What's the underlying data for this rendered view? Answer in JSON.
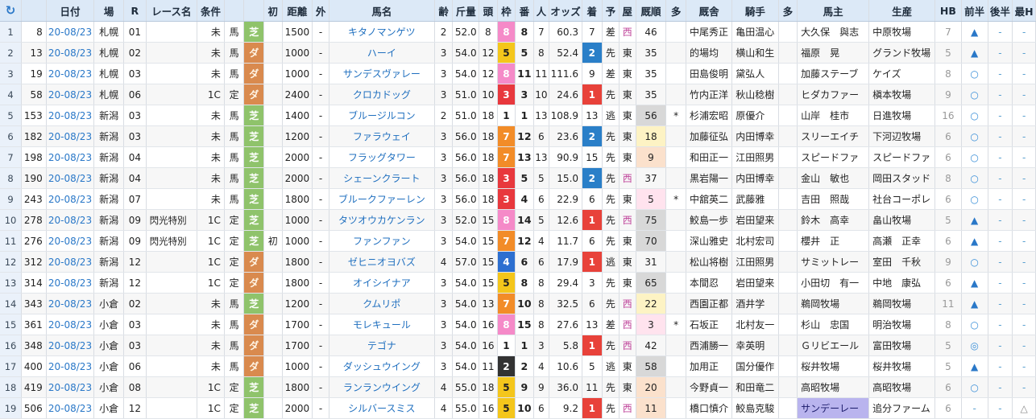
{
  "headers": [
    "",
    "日付",
    "場",
    "R",
    "レース名",
    "条件",
    "",
    "",
    "初",
    "距離",
    "外",
    "馬名",
    "齢",
    "斤量",
    "頭",
    "枠",
    "番",
    "人",
    "オッズ",
    "着",
    "予",
    "屋",
    "厩順",
    "多",
    "厩舎",
    "騎手",
    "多",
    "馬主",
    "生産",
    "HB",
    "前半",
    "後半",
    "最H"
  ],
  "refresh_glyph": "↻",
  "rows": [
    {
      "n": "1",
      "id": "8",
      "date": "20-08/23",
      "venue": "札幌",
      "r": "01",
      "race": "",
      "cls": "未",
      "sex": "馬",
      "course": "芝",
      "first": "",
      "dist": "1500",
      "out": "-",
      "horse": "キタノマンゲツ",
      "age": "2",
      "kin": "52.0",
      "tou": "8",
      "waku": "8",
      "ban": "8",
      "ninki": "7",
      "odds": "60.3",
      "chaku": "7",
      "yo": "差",
      "ya": "西",
      "rk": "46",
      "rkc": "",
      "ta": "",
      "trainer": "中尾秀正",
      "jockey": "亀田温心",
      "ta2": "",
      "owner": "大久保　與志",
      "breeder": "中原牧場",
      "hb": "7",
      "zen": "▲",
      "kou": "-",
      "sai": "-"
    },
    {
      "n": "2",
      "id": "13",
      "date": "20-08/23",
      "venue": "札幌",
      "r": "02",
      "race": "",
      "cls": "未",
      "sex": "馬",
      "course": "ダ",
      "first": "",
      "dist": "1000",
      "out": "-",
      "horse": "ハーイ",
      "age": "3",
      "kin": "54.0",
      "tou": "12",
      "waku": "5",
      "ban": "5",
      "ninki": "8",
      "odds": "52.4",
      "chaku": "2",
      "yo": "先",
      "ya": "東",
      "rk": "35",
      "rkc": "",
      "ta": "",
      "trainer": "的場均",
      "jockey": "横山和生",
      "ta2": "",
      "owner": "福原　晃",
      "breeder": "グランド牧場",
      "hb": "5",
      "zen": "▲",
      "kou": "-",
      "sai": "-"
    },
    {
      "n": "3",
      "id": "19",
      "date": "20-08/23",
      "venue": "札幌",
      "r": "03",
      "race": "",
      "cls": "未",
      "sex": "馬",
      "course": "ダ",
      "first": "",
      "dist": "1000",
      "out": "-",
      "horse": "サンデスヴァレー",
      "age": "3",
      "kin": "54.0",
      "tou": "12",
      "waku": "8",
      "ban": "11",
      "ninki": "11",
      "odds": "111.6",
      "chaku": "9",
      "yo": "差",
      "ya": "東",
      "rk": "35",
      "rkc": "",
      "ta": "",
      "trainer": "田島俊明",
      "jockey": "黛弘人",
      "ta2": "",
      "owner": "加藤ステーブ",
      "breeder": "ケイズ",
      "hb": "8",
      "zen": "○",
      "kou": "-",
      "sai": "-"
    },
    {
      "n": "4",
      "id": "58",
      "date": "20-08/23",
      "venue": "札幌",
      "r": "06",
      "race": "",
      "cls": "1C",
      "sex": "定",
      "course": "ダ",
      "first": "",
      "dist": "2400",
      "out": "-",
      "horse": "クロカドッグ",
      "age": "3",
      "kin": "51.0",
      "tou": "10",
      "waku": "3",
      "ban": "3",
      "ninki": "10",
      "odds": "24.6",
      "chaku": "1",
      "yo": "先",
      "ya": "東",
      "rk": "35",
      "rkc": "",
      "ta": "",
      "trainer": "竹内正洋",
      "jockey": "秋山稔樹",
      "ta2": "",
      "owner": "ヒダカファー",
      "breeder": "槇本牧場",
      "hb": "9",
      "zen": "○",
      "kou": "-",
      "sai": "-"
    },
    {
      "n": "5",
      "id": "153",
      "date": "20-08/23",
      "venue": "新潟",
      "r": "03",
      "race": "",
      "cls": "未",
      "sex": "馬",
      "course": "芝",
      "first": "",
      "dist": "1400",
      "out": "-",
      "horse": "ブルージルコン",
      "age": "2",
      "kin": "51.0",
      "tou": "18",
      "waku": "1",
      "ban": "1",
      "ninki": "13",
      "odds": "108.9",
      "chaku": "13",
      "yo": "逃",
      "ya": "東",
      "rk": "56",
      "rkc": "gray",
      "ta": "*",
      "trainer": "杉浦宏昭",
      "jockey": "原優介",
      "ta2": "",
      "owner": "山岸　桂市",
      "breeder": "日進牧場",
      "hb": "16",
      "zen": "○",
      "kou": "-",
      "sai": "-"
    },
    {
      "n": "6",
      "id": "182",
      "date": "20-08/23",
      "venue": "新潟",
      "r": "03",
      "race": "",
      "cls": "未",
      "sex": "馬",
      "course": "芝",
      "first": "",
      "dist": "1200",
      "out": "-",
      "horse": "ファラウェイ",
      "age": "3",
      "kin": "56.0",
      "tou": "18",
      "waku": "7",
      "ban": "12",
      "ninki": "6",
      "odds": "23.6",
      "chaku": "2",
      "yo": "先",
      "ya": "東",
      "rk": "18",
      "rkc": "mid",
      "ta": "",
      "trainer": "加藤征弘",
      "jockey": "内田博幸",
      "ta2": "",
      "owner": "スリーエイチ",
      "breeder": "下河辺牧場",
      "hb": "6",
      "zen": "○",
      "kou": "-",
      "sai": "-"
    },
    {
      "n": "7",
      "id": "198",
      "date": "20-08/23",
      "venue": "新潟",
      "r": "04",
      "race": "",
      "cls": "未",
      "sex": "馬",
      "course": "芝",
      "first": "",
      "dist": "2000",
      "out": "-",
      "horse": "フラッグタワー",
      "age": "3",
      "kin": "56.0",
      "tou": "18",
      "waku": "7",
      "ban": "13",
      "ninki": "13",
      "odds": "90.9",
      "chaku": "15",
      "yo": "先",
      "ya": "東",
      "rk": "9",
      "rkc": "hi",
      "ta": "",
      "trainer": "和田正一",
      "jockey": "江田照男",
      "ta2": "",
      "owner": "スピードファ",
      "breeder": "スピードファ",
      "hb": "6",
      "zen": "○",
      "kou": "-",
      "sai": "-"
    },
    {
      "n": "8",
      "id": "190",
      "date": "20-08/23",
      "venue": "新潟",
      "r": "04",
      "race": "",
      "cls": "未",
      "sex": "馬",
      "course": "芝",
      "first": "",
      "dist": "2000",
      "out": "-",
      "horse": "シェーンクラート",
      "age": "3",
      "kin": "56.0",
      "tou": "18",
      "waku": "3",
      "ban": "5",
      "ninki": "5",
      "odds": "15.0",
      "chaku": "2",
      "yo": "先",
      "ya": "西",
      "rk": "37",
      "rkc": "",
      "ta": "",
      "trainer": "黒岩陽一",
      "jockey": "内田博幸",
      "ta2": "",
      "owner": "金山　敏也",
      "breeder": "岡田スタッド",
      "hb": "8",
      "zen": "○",
      "kou": "-",
      "sai": "-"
    },
    {
      "n": "9",
      "id": "243",
      "date": "20-08/23",
      "venue": "新潟",
      "r": "07",
      "race": "",
      "cls": "未",
      "sex": "馬",
      "course": "芝",
      "first": "",
      "dist": "1800",
      "out": "-",
      "horse": "ブルークファーレン",
      "age": "3",
      "kin": "56.0",
      "tou": "18",
      "waku": "3",
      "ban": "4",
      "ninki": "6",
      "odds": "22.9",
      "chaku": "6",
      "yo": "先",
      "ya": "東",
      "rk": "5",
      "rkc": "pink",
      "ta": "*",
      "trainer": "中舘英二",
      "jockey": "武藤雅",
      "ta2": "",
      "owner": "吉田　照哉",
      "breeder": "社台コーポレ",
      "hb": "6",
      "zen": "○",
      "kou": "-",
      "sai": "-"
    },
    {
      "n": "10",
      "id": "278",
      "date": "20-08/23",
      "venue": "新潟",
      "r": "09",
      "race": "閃光特別",
      "cls": "1C",
      "sex": "定",
      "course": "芝",
      "first": "",
      "dist": "1000",
      "out": "-",
      "horse": "タツオウカケンラン",
      "age": "3",
      "kin": "52.0",
      "tou": "15",
      "waku": "8",
      "ban": "14",
      "ninki": "5",
      "odds": "12.6",
      "chaku": "1",
      "yo": "先",
      "ya": "西",
      "rk": "75",
      "rkc": "gray",
      "ta": "",
      "trainer": "鮫島一歩",
      "jockey": "岩田望来",
      "ta2": "",
      "owner": "鈴木　高幸",
      "breeder": "畠山牧場",
      "hb": "5",
      "zen": "▲",
      "kou": "-",
      "sai": "-"
    },
    {
      "n": "11",
      "id": "276",
      "date": "20-08/23",
      "venue": "新潟",
      "r": "09",
      "race": "閃光特別",
      "cls": "1C",
      "sex": "定",
      "course": "芝",
      "first": "初",
      "dist": "1000",
      "out": "-",
      "horse": "ファンファン",
      "age": "3",
      "kin": "54.0",
      "tou": "15",
      "waku": "7",
      "ban": "12",
      "ninki": "4",
      "odds": "11.7",
      "chaku": "6",
      "yo": "先",
      "ya": "東",
      "rk": "70",
      "rkc": "gray",
      "ta": "",
      "trainer": "深山雅史",
      "jockey": "北村宏司",
      "ta2": "",
      "owner": "櫻井　正",
      "breeder": "高瀬　正幸",
      "hb": "6",
      "zen": "▲",
      "kou": "-",
      "sai": "-"
    },
    {
      "n": "12",
      "id": "312",
      "date": "20-08/23",
      "venue": "新潟",
      "r": "12",
      "race": "",
      "cls": "1C",
      "sex": "定",
      "course": "ダ",
      "first": "",
      "dist": "1800",
      "out": "-",
      "horse": "ゼヒニオヨバズ",
      "age": "4",
      "kin": "57.0",
      "tou": "15",
      "waku": "4",
      "ban": "6",
      "ninki": "6",
      "odds": "17.9",
      "chaku": "1",
      "yo": "逃",
      "ya": "東",
      "rk": "31",
      "rkc": "",
      "ta": "",
      "trainer": "松山将樹",
      "jockey": "江田照男",
      "ta2": "",
      "owner": "サミットレー",
      "breeder": "室田　千秋",
      "hb": "9",
      "zen": "○",
      "kou": "-",
      "sai": "-"
    },
    {
      "n": "13",
      "id": "314",
      "date": "20-08/23",
      "venue": "新潟",
      "r": "12",
      "race": "",
      "cls": "1C",
      "sex": "定",
      "course": "ダ",
      "first": "",
      "dist": "1800",
      "out": "-",
      "horse": "オイシイナア",
      "age": "3",
      "kin": "54.0",
      "tou": "15",
      "waku": "5",
      "ban": "8",
      "ninki": "8",
      "odds": "29.4",
      "chaku": "3",
      "yo": "先",
      "ya": "東",
      "rk": "65",
      "rkc": "gray",
      "ta": "",
      "trainer": "本間忍",
      "jockey": "岩田望来",
      "ta2": "",
      "owner": "小田切　有一",
      "breeder": "中地　康弘",
      "hb": "6",
      "zen": "▲",
      "kou": "-",
      "sai": "-"
    },
    {
      "n": "14",
      "id": "343",
      "date": "20-08/23",
      "venue": "小倉",
      "r": "02",
      "race": "",
      "cls": "未",
      "sex": "馬",
      "course": "芝",
      "first": "",
      "dist": "1200",
      "out": "-",
      "horse": "クムリポ",
      "age": "3",
      "kin": "54.0",
      "tou": "13",
      "waku": "7",
      "ban": "10",
      "ninki": "8",
      "odds": "32.5",
      "chaku": "6",
      "yo": "先",
      "ya": "西",
      "rk": "22",
      "rkc": "mid",
      "ta": "",
      "trainer": "西園正都",
      "jockey": "酒井学",
      "ta2": "",
      "owner": "鵜岡牧場",
      "breeder": "鵜岡牧場",
      "hb": "11",
      "zen": "▲",
      "kou": "-",
      "sai": "-"
    },
    {
      "n": "15",
      "id": "361",
      "date": "20-08/23",
      "venue": "小倉",
      "r": "03",
      "race": "",
      "cls": "未",
      "sex": "馬",
      "course": "ダ",
      "first": "",
      "dist": "1700",
      "out": "-",
      "horse": "モレキュール",
      "age": "3",
      "kin": "54.0",
      "tou": "16",
      "waku": "8",
      "ban": "15",
      "ninki": "8",
      "odds": "27.6",
      "chaku": "13",
      "yo": "差",
      "ya": "西",
      "rk": "3",
      "rkc": "pink",
      "ta": "*",
      "trainer": "石坂正",
      "jockey": "北村友一",
      "ta2": "",
      "owner": "杉山　忠国",
      "breeder": "明治牧場",
      "hb": "8",
      "zen": "○",
      "kou": "-",
      "sai": "-"
    },
    {
      "n": "16",
      "id": "348",
      "date": "20-08/23",
      "venue": "小倉",
      "r": "03",
      "race": "",
      "cls": "未",
      "sex": "馬",
      "course": "ダ",
      "first": "",
      "dist": "1700",
      "out": "-",
      "horse": "テゴナ",
      "age": "3",
      "kin": "54.0",
      "tou": "16",
      "waku": "1",
      "ban": "1",
      "ninki": "3",
      "odds": "5.8",
      "chaku": "1",
      "yo": "先",
      "ya": "西",
      "rk": "42",
      "rkc": "",
      "ta": "",
      "trainer": "西浦勝一",
      "jockey": "幸英明",
      "ta2": "",
      "owner": "Ｇリビエール",
      "breeder": "富田牧場",
      "hb": "5",
      "zen": "◎",
      "kou": "-",
      "sai": "-"
    },
    {
      "n": "17",
      "id": "400",
      "date": "20-08/23",
      "venue": "小倉",
      "r": "06",
      "race": "",
      "cls": "未",
      "sex": "馬",
      "course": "ダ",
      "first": "",
      "dist": "1000",
      "out": "-",
      "horse": "ダッシュウイング",
      "age": "3",
      "kin": "54.0",
      "tou": "11",
      "waku": "2",
      "ban": "2",
      "ninki": "4",
      "odds": "10.6",
      "chaku": "5",
      "yo": "逃",
      "ya": "東",
      "rk": "58",
      "rkc": "gray",
      "ta": "",
      "trainer": "加用正",
      "jockey": "国分優作",
      "ta2": "",
      "owner": "桜井牧場",
      "breeder": "桜井牧場",
      "hb": "5",
      "zen": "▲",
      "kou": "-",
      "sai": "-"
    },
    {
      "n": "18",
      "id": "419",
      "date": "20-08/23",
      "venue": "小倉",
      "r": "08",
      "race": "",
      "cls": "1C",
      "sex": "定",
      "course": "芝",
      "first": "",
      "dist": "1800",
      "out": "-",
      "horse": "ランランウイング",
      "age": "4",
      "kin": "55.0",
      "tou": "18",
      "waku": "5",
      "ban": "9",
      "ninki": "9",
      "odds": "36.0",
      "chaku": "11",
      "yo": "先",
      "ya": "東",
      "rk": "20",
      "rkc": "hi",
      "ta": "",
      "trainer": "今野貞一",
      "jockey": "和田竜二",
      "ta2": "",
      "owner": "高昭牧場",
      "breeder": "高昭牧場",
      "hb": "6",
      "zen": "○",
      "kou": "-",
      "sai": "-"
    },
    {
      "n": "19",
      "id": "506",
      "date": "20-08/23",
      "venue": "小倉",
      "r": "12",
      "race": "",
      "cls": "1C",
      "sex": "定",
      "course": "芝",
      "first": "",
      "dist": "2000",
      "out": "-",
      "horse": "シルバースミス",
      "age": "4",
      "kin": "55.0",
      "tou": "16",
      "waku": "5",
      "ban": "10",
      "ninki": "6",
      "odds": "9.2",
      "chaku": "1",
      "yo": "先",
      "ya": "西",
      "rk": "11",
      "rkc": "hi",
      "ta": "",
      "trainer": "橋口慎介",
      "jockey": "鮫島克駿",
      "ta2": "",
      "owner": "サンデーレー",
      "owner_hl": true,
      "breeder": "追分ファーム",
      "hb": "6",
      "zen": "-",
      "kou": "-",
      "sai": "△"
    }
  ]
}
